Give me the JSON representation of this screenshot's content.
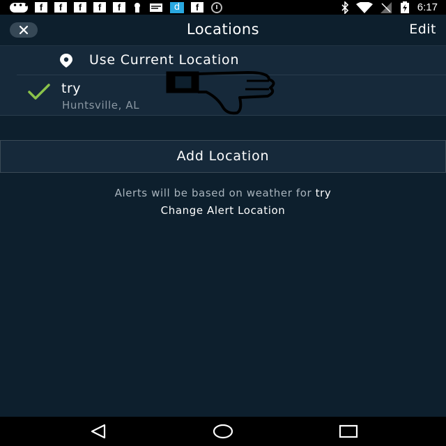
{
  "status_bar": {
    "time": "6:17",
    "left_icons": [
      "messages-icon",
      "facebook-icon",
      "facebook-icon",
      "facebook-icon",
      "facebook-icon",
      "facebook-icon",
      "keyhole-icon",
      "mail-icon",
      "d-app-icon",
      "facebook-icon",
      "target-icon"
    ],
    "right_icons": [
      "bluetooth-icon",
      "wifi-icon",
      "no-signal-icon",
      "battery-charging-icon"
    ],
    "fb_glyph": "f",
    "d_glyph": "d"
  },
  "header": {
    "title": "Locations",
    "edit_label": "Edit",
    "close_icon": "close-icon"
  },
  "locations": {
    "current_label": "Use Current Location",
    "saved": [
      {
        "name": "try",
        "subtitle": "Huntsville, AL",
        "selected": true
      }
    ]
  },
  "add_location_label": "Add Location",
  "alerts": {
    "prefix": "Alerts will be based on weather for ",
    "location": "try",
    "change_label": "Change Alert Location"
  },
  "colors": {
    "background": "#0d1f2d",
    "panel": "#16293a",
    "check": "#8bc34a",
    "muted_text": "#8b98a3"
  }
}
